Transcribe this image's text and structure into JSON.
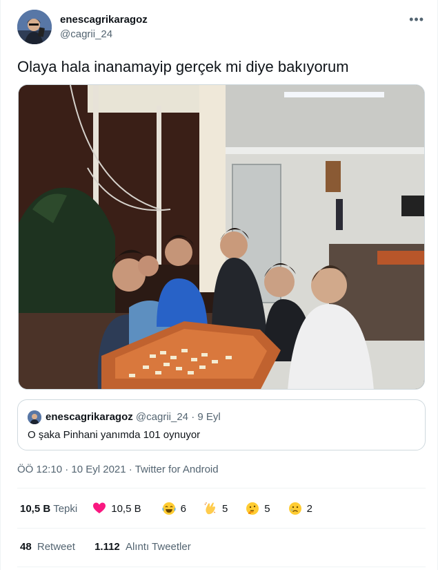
{
  "author": {
    "display_name": "enescagrikaragoz",
    "handle": "@cagrii_24"
  },
  "menu_icon": "more-dots-icon",
  "tweet": {
    "text": "Olaya hala inanamayip gerçek mi diye bakıyorum"
  },
  "quoted": {
    "display_name": "enescagrikaragoz",
    "handle": "@cagrii_24",
    "separator": "·",
    "date": "9 Eyl",
    "text": "O şaka Pinhani yanımda 101 oynuyor"
  },
  "meta": {
    "time": "ÖÖ 12:10",
    "separator": "·",
    "date": "10 Eyl 2021",
    "source": "Twitter for Android"
  },
  "reactions": {
    "total": "10,5 B",
    "total_label": "Tepki",
    "items": [
      {
        "icon": "heart-icon",
        "count": "10,5 B",
        "color": "#f91880"
      },
      {
        "icon": "laughing-face-icon",
        "count": "6"
      },
      {
        "icon": "clapping-hands-icon",
        "count": "5"
      },
      {
        "icon": "thinking-face-icon",
        "count": "5"
      },
      {
        "icon": "sad-face-icon",
        "count": "2"
      }
    ]
  },
  "stats": {
    "retweets": "48",
    "retweets_label": "Retweet",
    "quotes": "1.112",
    "quotes_label": "Alıntı Tweetler"
  },
  "colors": {
    "text": "#0f1419",
    "secondary": "#536471",
    "border": "#cfd9de"
  }
}
